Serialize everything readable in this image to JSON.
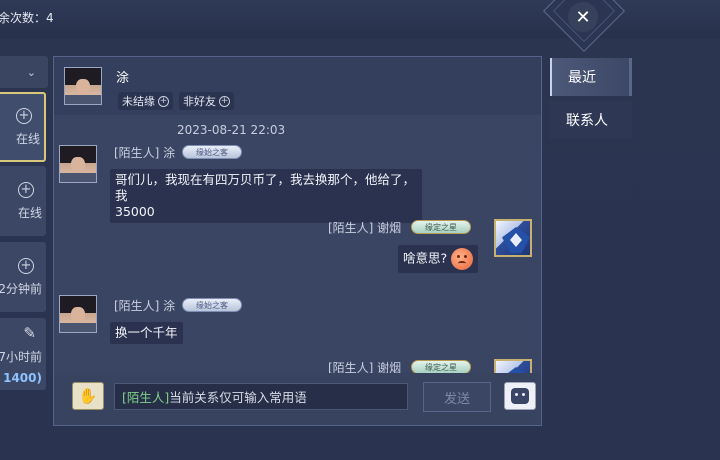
{
  "top": {
    "remaining_text": "余次数：4",
    "close_icon": "close-x-icon"
  },
  "left_list": {
    "dropdown_icon": "chevron-down-icon",
    "items": [
      {
        "status": "在线",
        "icon": "plus-icon",
        "active": true
      },
      {
        "status": "在线",
        "icon": "plus-icon"
      },
      {
        "status": "2分钟前",
        "icon": "plus-icon"
      },
      {
        "status": "7小时前",
        "icon": "brush-icon",
        "sub": "1400)"
      }
    ]
  },
  "header": {
    "name": "涂",
    "tags": [
      {
        "label": "未结缘",
        "icon": "plus-circle-icon"
      },
      {
        "label": "非好友",
        "icon": "plus-circle-icon"
      }
    ]
  },
  "chat": {
    "timestamp": "2023-08-21  22:03",
    "messages": [
      {
        "side": "left",
        "sender": "[陌生人] 涂",
        "badge": "缘始之客",
        "line1": "哥们儿，我现在有四万贝币了，我去换那个，他给了，我",
        "line2": "35000"
      },
      {
        "side": "right",
        "sender": "[陌生人] 谢烟",
        "badge": "缘定之星",
        "text": "啥意思?",
        "emoji": "face-emoji-icon"
      },
      {
        "side": "left",
        "sender": "[陌生人] 涂",
        "badge": "缘始之客",
        "text": "换一个千年"
      },
      {
        "side": "right",
        "sender": "[陌生人] 谢烟",
        "badge": "缘定之星"
      }
    ]
  },
  "input": {
    "prefix": "[陌生人]",
    "text": "当前关系仅可输入常用语",
    "send_label": "发送",
    "hand_icon": "hand-icon",
    "emoji_icon": "emoji-face-icon"
  },
  "tabs": [
    {
      "label": "最近",
      "active": true
    },
    {
      "label": "联系人"
    }
  ]
}
